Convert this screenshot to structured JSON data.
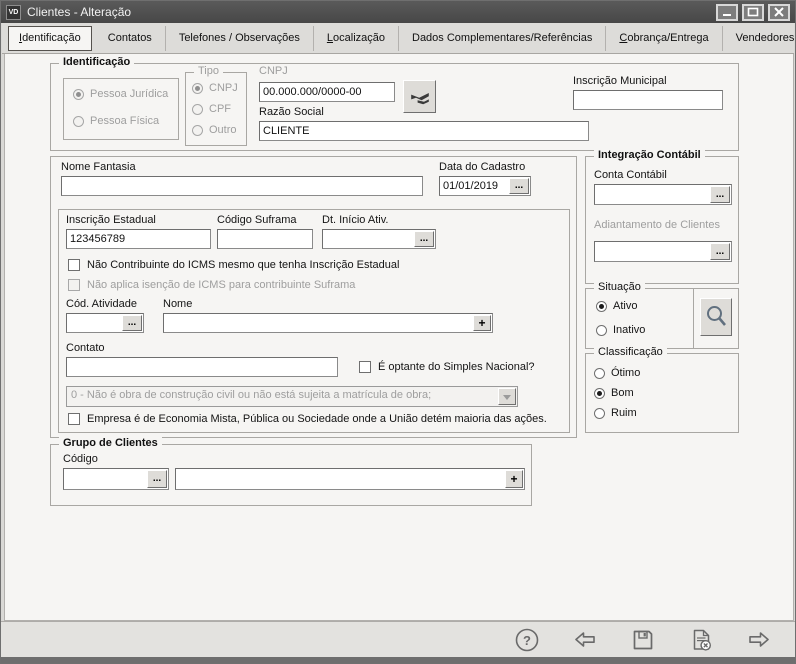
{
  "window": {
    "title": "Clientes - Alteração",
    "icon_text": "VD"
  },
  "tabs": {
    "items": [
      {
        "label": "Identificação"
      },
      {
        "label": "Contatos"
      },
      {
        "label": "Telefones / Observações"
      },
      {
        "label": "Localização"
      },
      {
        "label": "Dados Complementares/Referências"
      },
      {
        "label": "Cobrança/Entrega"
      },
      {
        "label": "Vendedores"
      }
    ],
    "active": "Identificação"
  },
  "identificacao": {
    "legend": "Identificação",
    "pessoa_juridica": "Pessoa Jurídica",
    "pessoa_fisica": "Pessoa Física",
    "pessoa_selected": "Pessoa Jurídica",
    "tipo_legend": "Tipo",
    "tipo_cnpj": "CNPJ",
    "tipo_cpf": "CPF",
    "tipo_outro": "Outro",
    "tipo_selected": "CNPJ",
    "cnpj_label": "CNPJ",
    "cnpj_value": "00.000.000/0000-00",
    "razao_label": "Razão Social",
    "razao_value": "CLIENTE",
    "inscricao_municipal_label": "Inscrição Municipal",
    "inscricao_municipal_value": ""
  },
  "main": {
    "nome_fantasia_label": "Nome Fantasia",
    "nome_fantasia_value": "",
    "data_cadastro_label": "Data do Cadastro",
    "data_cadastro_value": "01/01/2019",
    "inscricao_estadual_label": "Inscrição Estadual",
    "inscricao_estadual_value": "123456789",
    "codigo_suframa_label": "Código Suframa",
    "codigo_suframa_value": "",
    "dt_inicio_label": "Dt. Início Ativ.",
    "dt_inicio_value": "",
    "chk_nao_contribuinte": "Não Contribuinte do ICMS mesmo que tenha Inscrição Estadual",
    "chk_nao_isencao": "Não aplica isenção de ICMS para contribuinte Suframa",
    "cod_atividade_label": "Cód. Atividade",
    "cod_atividade_value": "",
    "nome_label": "Nome",
    "nome_value": "",
    "contato_label": "Contato",
    "contato_value": "",
    "chk_simples": "É optante do Simples Nacional?",
    "obra_dropdown_value": "0 - Não é obra de construção civil ou não está sujeita a matrícula de obra;",
    "chk_economia_mista": "Empresa é de Economia Mista, Pública ou Sociedade onde a União detém maioria das ações."
  },
  "integracao": {
    "legend": "Integração Contábil",
    "conta_label": "Conta Contábil",
    "conta_value": "",
    "adiantamento_label": "Adiantamento de Clientes",
    "adiantamento_value": ""
  },
  "situacao": {
    "legend": "Situação",
    "ativo": "Ativo",
    "inativo": "Inativo",
    "selected": "Ativo"
  },
  "classificacao": {
    "legend": "Classificação",
    "otimo": "Ótimo",
    "bom": "Bom",
    "ruim": "Ruim",
    "selected": "Bom"
  },
  "grupo_clientes": {
    "legend": "Grupo de Clientes",
    "codigo_label": "Código",
    "codigo_value": "",
    "nome_value": ""
  },
  "buttons": {
    "ellipsis": "...",
    "plus": "+"
  },
  "toolbar": {
    "icons": [
      "help",
      "back",
      "save",
      "cancel-document",
      "forward"
    ]
  },
  "colors": {
    "titlebar": "#4e4e4e",
    "content_bg": "#f6f5f3",
    "disabled_text": "#9e9e9e",
    "toolbar_bg": "#e3e2df"
  }
}
